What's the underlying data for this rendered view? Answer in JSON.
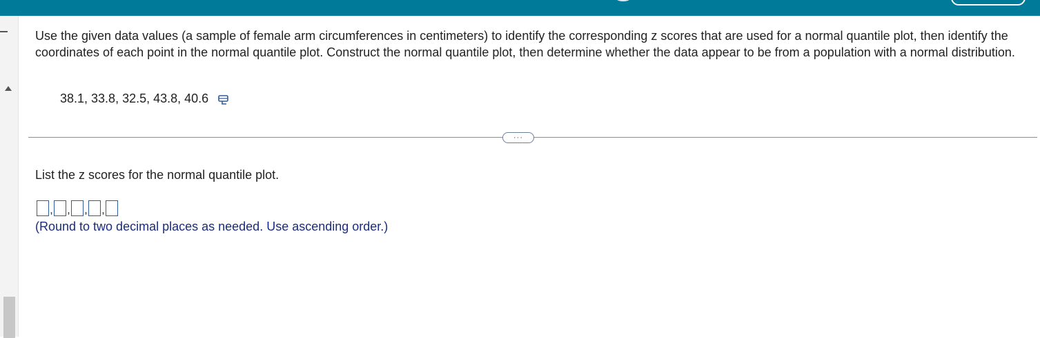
{
  "question": {
    "text": "Use the given data values (a sample of female arm circumferences in centimeters) to identify the corresponding z scores that are used for a normal quantile plot, then identify the coordinates of each point in the normal quantile plot. Construct the normal quantile plot, then determine whether the data appear to be from a population with a normal distribution.",
    "data_values": "38.1, 33.8, 32.5, 43.8, 40.6"
  },
  "more_button": {
    "label": "···"
  },
  "part": {
    "prompt": "List the z scores for the normal quantile plot.",
    "answers": [
      "",
      "",
      "",
      "",
      ""
    ],
    "separator": ",",
    "hint": "(Round to two decimal places as needed. Use ascending order.)"
  },
  "icons": {
    "copy": "copy-data-icon",
    "more": "ellipsis-icon"
  },
  "colors": {
    "topbar": "#007a99",
    "hint_text": "#1a2b80",
    "input_border": "#2f5a9e"
  }
}
